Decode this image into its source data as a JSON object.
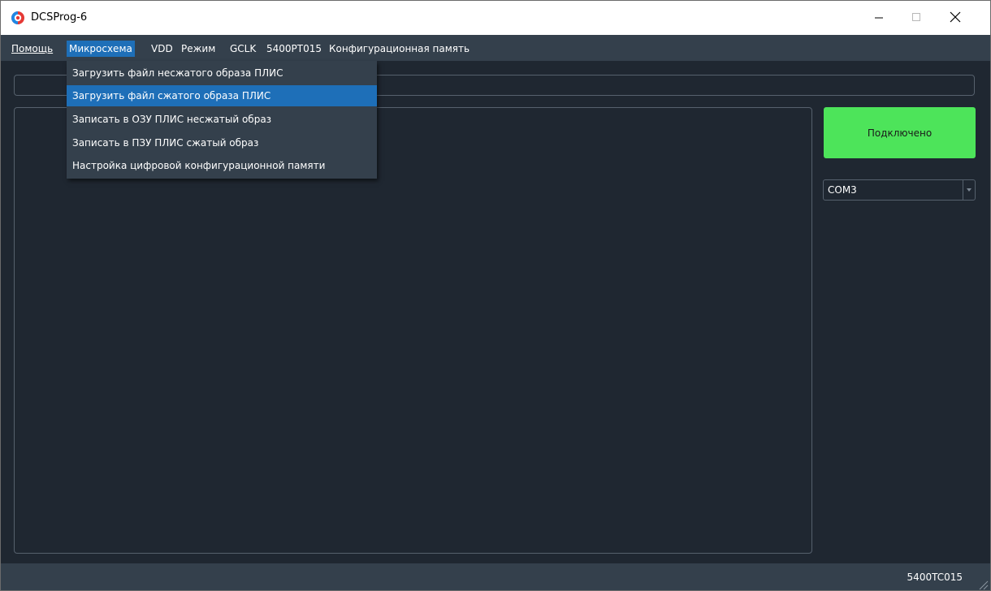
{
  "window": {
    "title": "DCSProg-6"
  },
  "menubar": {
    "items": [
      {
        "label": "Помощь"
      },
      {
        "label": "Микросхема"
      },
      {
        "label": "VDD"
      },
      {
        "label": "Режим"
      },
      {
        "label": "GCLK"
      },
      {
        "label": "5400PT015"
      },
      {
        "label": "Конфигурационная память"
      }
    ],
    "active_item": "Микросхема"
  },
  "dropdown": {
    "items": [
      {
        "label": "Загрузить файл несжатого образа ПЛИС"
      },
      {
        "label": "Загрузить файл сжатого образа ПЛИС"
      },
      {
        "label": "Записать в ОЗУ ПЛИС несжатый образ"
      },
      {
        "label": "Записать в ПЗУ ПЛИС сжатый образ"
      },
      {
        "label": "Настройка цифровой конфигурационной памяти"
      }
    ],
    "highlighted_item": "Загрузить файл сжатого образа ПЛИС"
  },
  "main": {
    "path_field_value": "",
    "log_text": ""
  },
  "sidebar": {
    "connect_button_label": "Подключено",
    "port_select_value": "COM3"
  },
  "statusbar": {
    "chip_label": "5400TC015"
  },
  "colors": {
    "background": "#1f2731",
    "bar": "#34404c",
    "accent": "#1e6fb8",
    "connected": "#4de45a",
    "border": "#56616d"
  },
  "icons": {
    "app": "app-logo-icon",
    "minimize": "minimize-icon",
    "maximize": "maximize-icon",
    "close": "close-icon",
    "dropdown_arrow": "chevron-down-icon",
    "resize": "resize-grip-icon"
  }
}
